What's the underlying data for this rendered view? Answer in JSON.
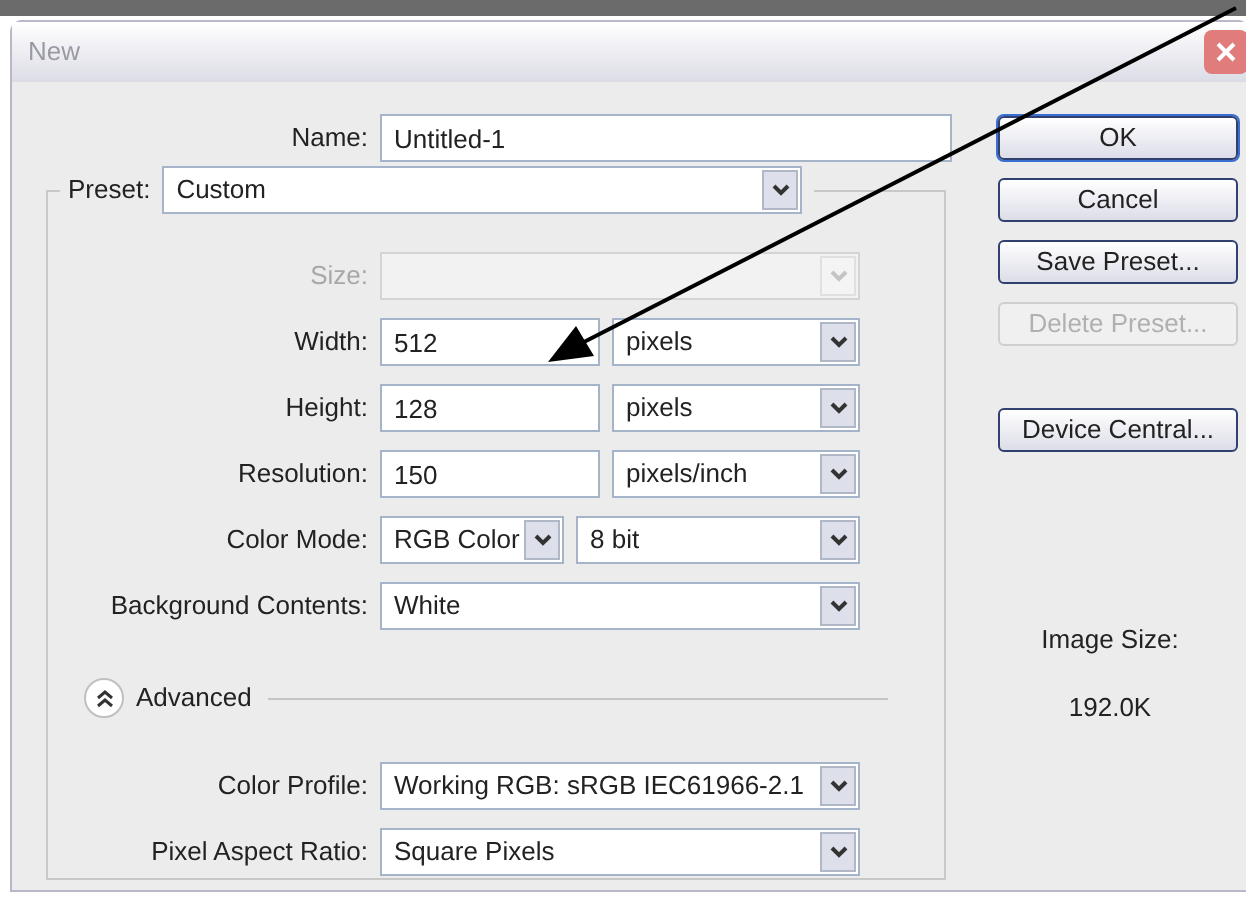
{
  "window": {
    "title": "New"
  },
  "name_field": {
    "label": "Name:",
    "value": "Untitled-1"
  },
  "preset": {
    "label": "Preset:",
    "value": "Custom"
  },
  "rows": [
    {
      "kind": "select",
      "label": "Size:",
      "disabled": true
    },
    {
      "kind": "input-select",
      "label": "Width:",
      "value": "512",
      "unit": "pixels",
      "disabled": false
    },
    {
      "kind": "input-select",
      "label": "Height:",
      "value": "128",
      "unit": "pixels",
      "disabled": false
    },
    {
      "kind": "input-select",
      "label": "Resolution:",
      "value": "150",
      "unit": "pixels/inch",
      "disabled": false
    },
    {
      "kind": "select-pair",
      "label": "Color Mode:",
      "value": "RGB Color",
      "unit": "8 bit",
      "disabled": false
    },
    {
      "kind": "select",
      "label": "Background Contents:",
      "value": "White",
      "disabled": false
    }
  ],
  "advanced": {
    "label": "Advanced",
    "expanded": true
  },
  "advanced_rows": [
    {
      "kind": "select",
      "label": "Color Profile:",
      "value": "Working RGB:  sRGB IEC61966-2.1",
      "disabled": false
    },
    {
      "kind": "select",
      "label": "Pixel Aspect Ratio:",
      "value": "Square Pixels",
      "disabled": false
    }
  ],
  "buttons": [
    {
      "label": "OK",
      "disabled": false,
      "default": true
    },
    {
      "label": "Cancel",
      "disabled": false,
      "default": false
    },
    {
      "label": "Save Preset...",
      "disabled": false,
      "default": false
    },
    {
      "label": "Delete Preset...",
      "disabled": true,
      "default": false
    },
    {
      "label": "Device Central...",
      "disabled": false,
      "default": false
    }
  ],
  "image_size": {
    "label": "Image Size:",
    "value": "192.0K"
  }
}
